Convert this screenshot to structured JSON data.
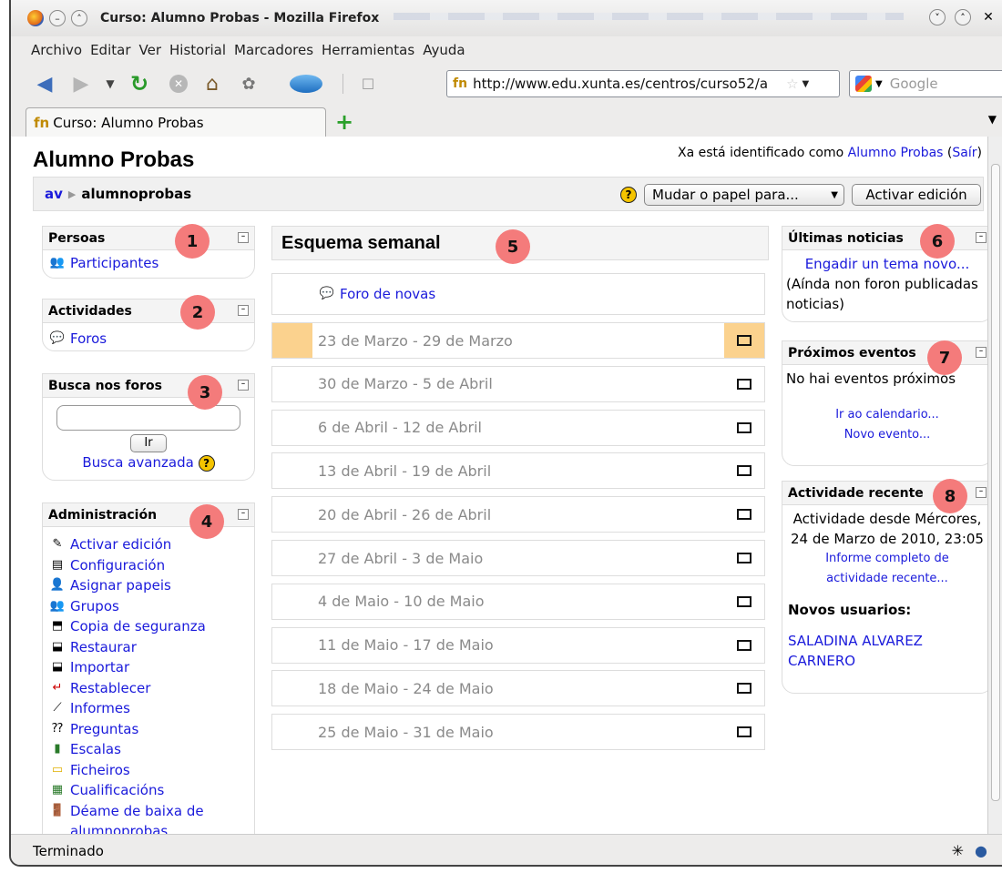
{
  "window": {
    "title": "Curso: Alumno Probas - Mozilla Firefox"
  },
  "menu": [
    "Archivo",
    "Editar",
    "Ver",
    "Historial",
    "Marcadores",
    "Herramientas",
    "Ayuda"
  ],
  "nav": {
    "url": "http://www.edu.xunta.es/centros/curso52/a",
    "url_favicon": "fn",
    "search_placeholder": "Google"
  },
  "tab": {
    "favicon": "fn",
    "label": "Curso: Alumno Probas"
  },
  "page": {
    "title": "Alumno Probas",
    "login_prefix": "Xa está identificado como ",
    "login_user": "Alumno Probas",
    "logout_open": " (",
    "logout": "Saír",
    "logout_close": ")",
    "breadcrumb_home": "av",
    "breadcrumb_sep": "▶",
    "breadcrumb_current": "alumnoprobas",
    "help_symbol": "?",
    "role_select": "Mudar o papel para...",
    "edit_button": "Activar edición"
  },
  "blocks_left": {
    "people": {
      "title": "Persoas",
      "badge": "1",
      "items": [
        {
          "label": "Participantes",
          "icon": "people-icon"
        }
      ]
    },
    "activities": {
      "title": "Actividades",
      "badge": "2",
      "items": [
        {
          "label": "Foros",
          "icon": "forum-icon"
        }
      ]
    },
    "search": {
      "title": "Busca nos foros",
      "badge": "3",
      "button": "Ir",
      "advanced": "Busca avanzada"
    },
    "admin": {
      "title": "Administración",
      "badge": "4",
      "items": [
        {
          "label": "Activar edición",
          "icon": "edit-icon"
        },
        {
          "label": "Configuración",
          "icon": "settings-icon"
        },
        {
          "label": "Asignar papeis",
          "icon": "roles-icon"
        },
        {
          "label": "Grupos",
          "icon": "groups-icon"
        },
        {
          "label": "Copia de seguranza",
          "icon": "backup-icon"
        },
        {
          "label": "Restaurar",
          "icon": "restore-icon"
        },
        {
          "label": "Importar",
          "icon": "import-icon"
        },
        {
          "label": "Restablecer",
          "icon": "reset-icon"
        },
        {
          "label": "Informes",
          "icon": "reports-icon"
        },
        {
          "label": "Preguntas",
          "icon": "questions-icon"
        },
        {
          "label": "Escalas",
          "icon": "scales-icon"
        },
        {
          "label": "Ficheiros",
          "icon": "folder-icon"
        },
        {
          "label": "Cualificacións",
          "icon": "grades-icon"
        },
        {
          "label": "Déame de baixa de alumnoprobas",
          "icon": "unenrol-icon"
        }
      ]
    }
  },
  "center": {
    "title": "Esquema semanal",
    "badge": "5",
    "forum": "Foro de novas",
    "weeks": [
      "23 de Marzo - 29 de Marzo",
      "30 de Marzo - 5 de Abril",
      "6 de Abril - 12 de Abril",
      "13 de Abril - 19 de Abril",
      "20 de Abril - 26 de Abril",
      "27 de Abril - 3 de Maio",
      "4 de Maio - 10 de Maio",
      "11 de Maio - 17 de Maio",
      "18 de Maio - 24 de Maio",
      "25 de Maio - 31 de Maio"
    ],
    "current_week_index": 0,
    "highlight_color": "#fbd28e"
  },
  "blocks_right": {
    "news": {
      "title": "Últimas noticias",
      "badge": "6",
      "add_link": "Engadir un tema novo...",
      "empty_text": "(Aínda non foron publicadas noticias)"
    },
    "events": {
      "title": "Próximos eventos",
      "badge": "7",
      "empty_text": "No hai eventos próximos",
      "calendar_link": "Ir ao calendario...",
      "new_event_link": "Novo evento..."
    },
    "recent": {
      "title": "Actividade recente",
      "badge": "8",
      "since_text": "Actividade desde Mércores, 24 de Marzo de 2010, 23:05",
      "full_report_link": "Informe completo de actividade recente...",
      "new_users_title": "Novos usuarios:",
      "new_user": "SALADINA ALVAREZ CARNERO"
    }
  },
  "status": {
    "text": "Terminado"
  },
  "colors": {
    "link": "#1a1adb",
    "badge": "#f47b7b"
  }
}
